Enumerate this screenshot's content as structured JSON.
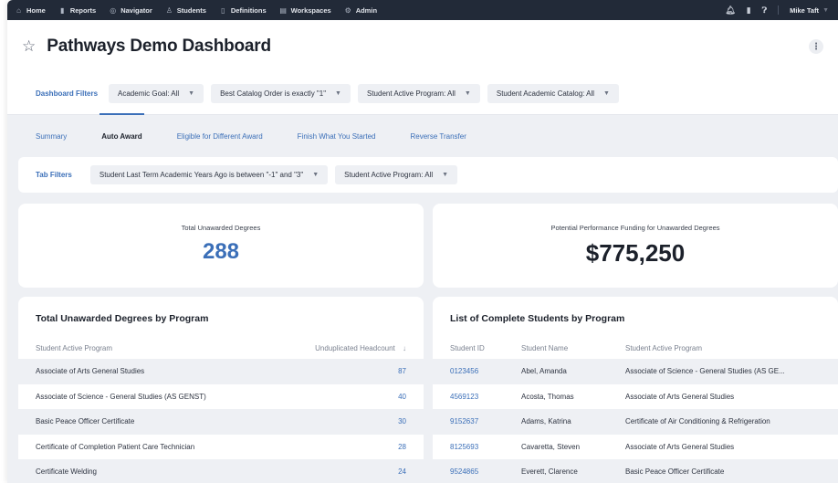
{
  "nav": {
    "items": [
      {
        "icon": "home-icon",
        "glyph": "⌂",
        "label": "Home"
      },
      {
        "icon": "reports-icon",
        "glyph": "▮",
        "label": "Reports"
      },
      {
        "icon": "navigator-icon",
        "glyph": "◎",
        "label": "Navigator"
      },
      {
        "icon": "students-icon",
        "glyph": "♙",
        "label": "Students"
      },
      {
        "icon": "definitions-icon",
        "glyph": "▯",
        "label": "Definitions"
      },
      {
        "icon": "workspaces-icon",
        "glyph": "▤",
        "label": "Workspaces"
      },
      {
        "icon": "admin-icon",
        "glyph": "⚙",
        "label": "Admin"
      }
    ],
    "user": "Mike Taft"
  },
  "header": {
    "title": "Pathways Demo Dashboard"
  },
  "dashboard_filters": {
    "label": "Dashboard Filters",
    "chips": [
      "Academic Goal: All",
      "Best Catalog Order is exactly \"1\"",
      "Student Active Program: All",
      "Student Academic Catalog: All"
    ]
  },
  "tabs": [
    {
      "label": "Summary",
      "active": false
    },
    {
      "label": "Auto Award",
      "active": true
    },
    {
      "label": "Eligible for Different Award",
      "active": false
    },
    {
      "label": "Finish What You Started",
      "active": false
    },
    {
      "label": "Reverse Transfer",
      "active": false
    }
  ],
  "tab_filters": {
    "label": "Tab Filters",
    "chips": [
      "Student Last Term Academic Years Ago is between \"-1\" and \"3\"",
      "Student Active Program: All"
    ]
  },
  "kpis": {
    "unawarded": {
      "label": "Total Unawarded Degrees",
      "value": "288"
    },
    "funding": {
      "label": "Potential Performance Funding for Unawarded Degrees",
      "value": "$775,250"
    }
  },
  "table_programs": {
    "title": "Total Unawarded Degrees by Program",
    "headers": [
      "Student Active Program",
      "Unduplicated Headcount"
    ],
    "rows": [
      {
        "program": "Associate of Arts General Studies",
        "count": "87"
      },
      {
        "program": "Associate of Science - General Studies (AS GENST)",
        "count": "40"
      },
      {
        "program": "Basic Peace Officer Certificate",
        "count": "30"
      },
      {
        "program": "Certificate of Completion Patient Care Technician",
        "count": "28"
      },
      {
        "program": "Certificate Welding",
        "count": "24"
      }
    ]
  },
  "table_students": {
    "title": "List of Complete Students by Program",
    "headers": [
      "Student ID",
      "Student Name",
      "Student Active Program"
    ],
    "rows": [
      {
        "id": "0123456",
        "name": "Abel, Amanda",
        "program": "Associate of Science - General Studies (AS GE..."
      },
      {
        "id": "4569123",
        "name": "Acosta, Thomas",
        "program": "Associate of Arts General Studies"
      },
      {
        "id": "9152637",
        "name": "Adams, Katrina",
        "program": "Certificate of Air Conditioning & Refrigeration"
      },
      {
        "id": "8125693",
        "name": "Cavaretta, Steven",
        "program": "Associate of Arts General Studies"
      },
      {
        "id": "9524865",
        "name": "Everett, Clarence",
        "program": "Basic Peace Officer Certificate"
      }
    ]
  },
  "colors": {
    "accent": "#3b6fb8",
    "topnav": "#222a38",
    "background": "#eef0f4"
  }
}
